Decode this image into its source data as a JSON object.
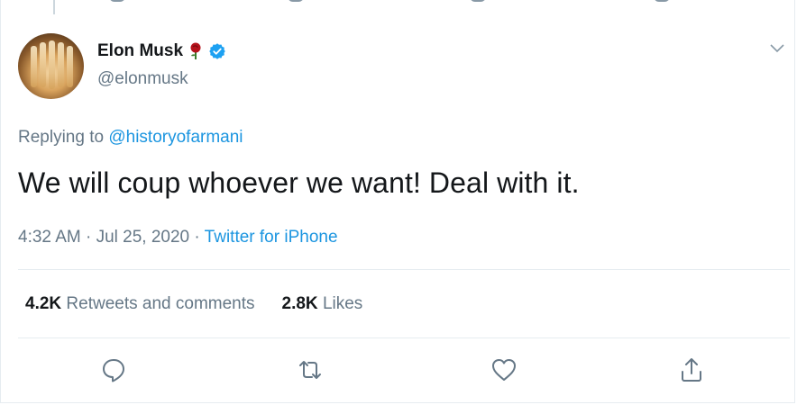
{
  "tweet": {
    "author": {
      "display_name": "Elon Musk",
      "handle": "@elonmusk",
      "emoji": "rose",
      "verified": true
    },
    "replying_to_prefix": "Replying to",
    "replying_to_user": "@historyofarmani",
    "text": "We will coup whoever we want! Deal with it.",
    "timestamp": "4:32 AM · Jul 25, 2020 · ",
    "source": "Twitter for iPhone",
    "stats": {
      "retweets_count": "4.2K",
      "retweets_label": "Retweets and comments",
      "likes_count": "2.8K",
      "likes_label": "Likes"
    }
  },
  "colors": {
    "text": "#14171a",
    "secondary": "#657786",
    "link": "#1b95e0",
    "divider": "#e6ecf0",
    "verified_badge": "#1da1f2"
  },
  "icons": [
    "chevron-down-icon",
    "reply-icon",
    "retweet-icon",
    "like-icon",
    "share-icon",
    "verified-badge-icon",
    "rose-emoji-icon"
  ]
}
